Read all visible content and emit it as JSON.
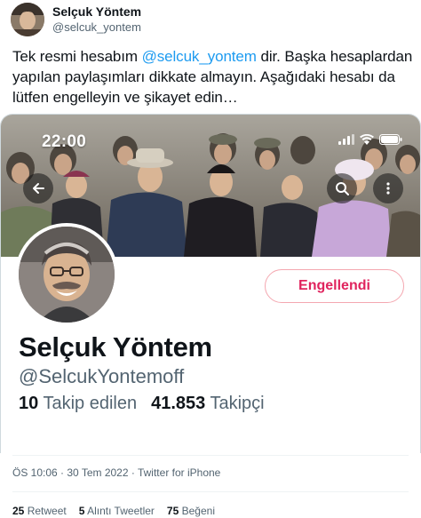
{
  "author": {
    "name": "Selçuk Yöntem",
    "handle": "@selcuk_yontem"
  },
  "tweet": {
    "text_before": "Tek resmi hesabım ",
    "mention": "@selcuk_yontem",
    "text_after": " dir. Başka hesaplardan yapılan paylaşımları dikkate almayın. Aşağıdaki hesabı da lütfen engelleyin ve şikayet edin…"
  },
  "media": {
    "status_time": "22:00",
    "profile": {
      "name": "Selçuk Yöntem",
      "handle": "@SelcukYontemoff",
      "blocked_label": "Engellendi",
      "following_count": "10",
      "following_label": "Takip edilen",
      "followers_count": "41.853",
      "followers_label": "Takipçi"
    }
  },
  "meta": {
    "timestamp": "ÖS 10:06 · 30 Tem 2022 · Twitter for iPhone"
  },
  "stats": {
    "retweets_count": "25",
    "retweets_label": "Retweet",
    "quotes_count": "5",
    "quotes_label": "Alıntı Tweetler",
    "likes_count": "75",
    "likes_label": "Beğeni"
  },
  "colors": {
    "link": "#1d9bf0",
    "blocked": "#e0245e"
  },
  "icons": [
    "back-arrow-icon",
    "search-icon",
    "more-icon",
    "signal-icon",
    "wifi-icon",
    "battery-icon"
  ]
}
